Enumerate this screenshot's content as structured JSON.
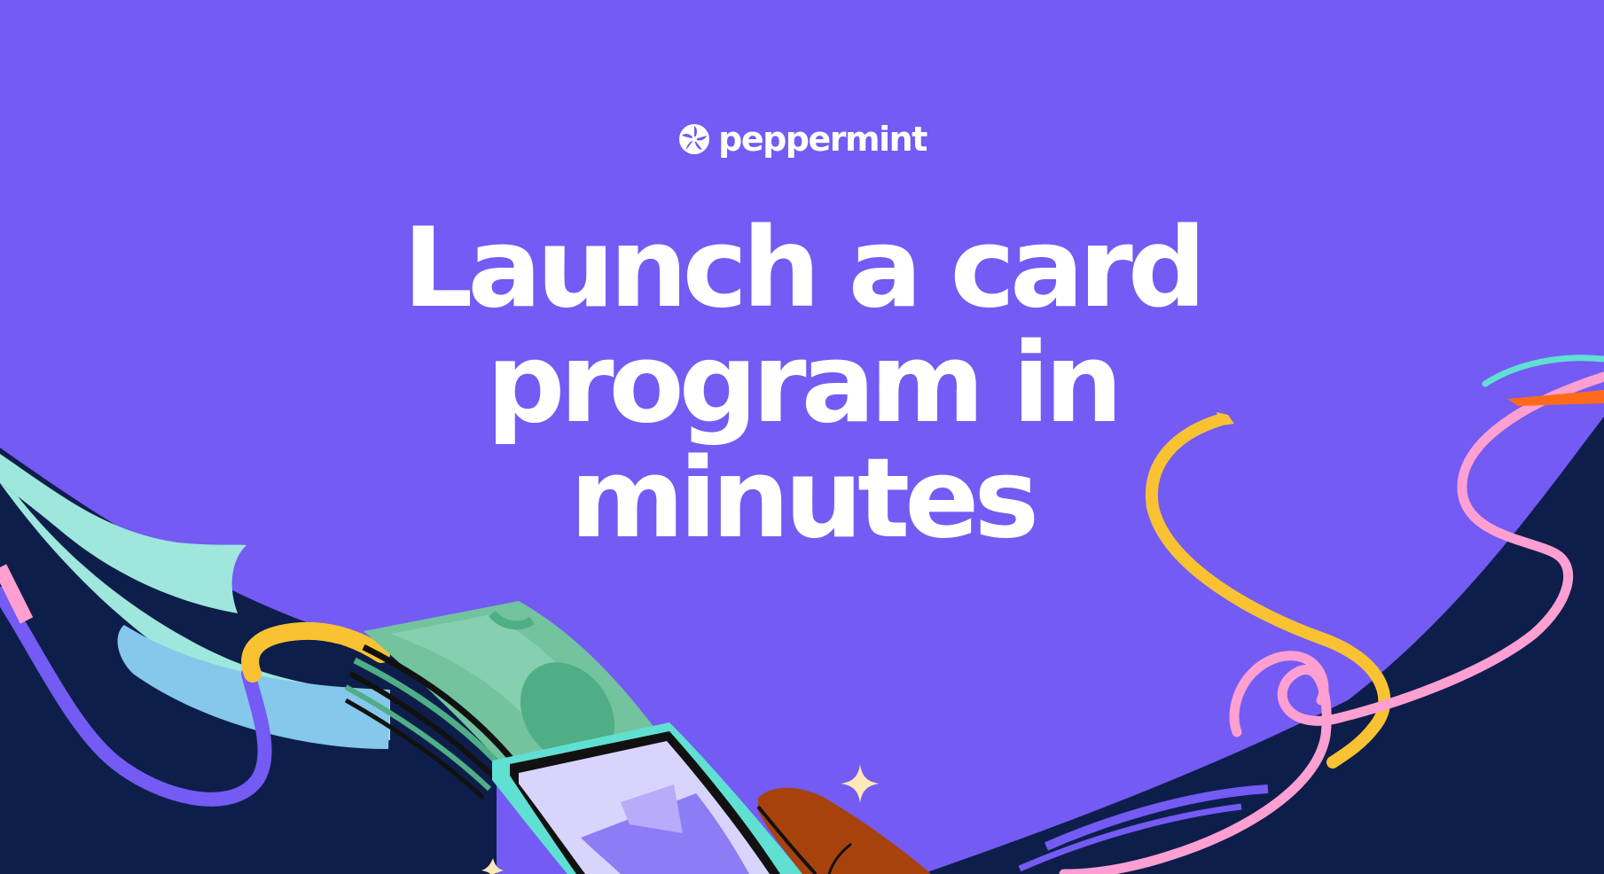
{
  "brand": {
    "name": "peppermint",
    "logo_icon": "peppermint-candy-icon"
  },
  "hero": {
    "headline_lines": [
      "Launch a card",
      "program in",
      "minutes"
    ]
  },
  "colors": {
    "background": "#735bf3",
    "navy": "#0e1e4b",
    "mint": "#9fe6dc",
    "sky": "#86c7ec",
    "yellow": "#f8c232",
    "pink": "#ff9fd2",
    "cash": "#72c39e",
    "cash_dark": "#4fae86",
    "teal": "#5fe0d2",
    "card": "#d8d4fb",
    "wallet": "#a8420d",
    "orange": "#ff6b1a"
  },
  "illustration": [
    "cash-icon",
    "phone-card-icon",
    "wallet-icon",
    "sparkle-icon",
    "ribbon-decoration"
  ]
}
